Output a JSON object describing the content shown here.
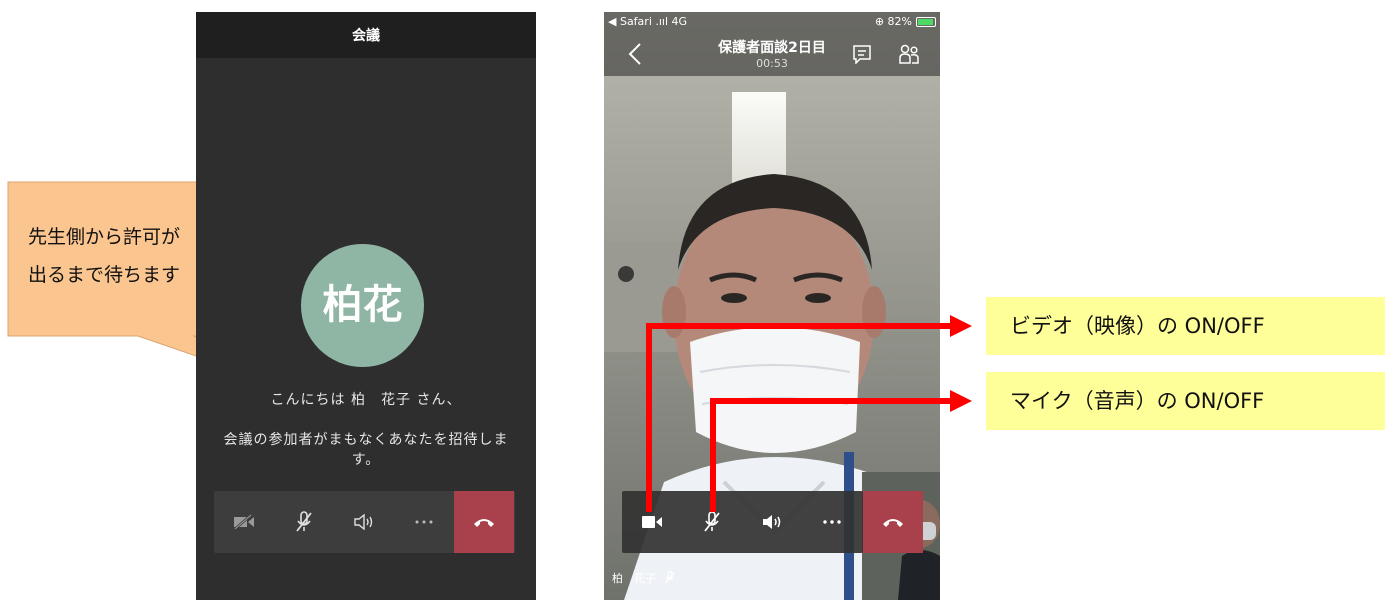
{
  "lobby": {
    "title": "会議",
    "avatar_initials": "柏花",
    "greeting": "こんにちは 柏　花子 さん、",
    "message": "会議の参加者がまもなくあなたを招待します。",
    "controls": [
      {
        "icon": "video-off-icon",
        "state": "off"
      },
      {
        "icon": "mic-muted-icon",
        "state": "muted"
      },
      {
        "icon": "speaker-icon",
        "state": "on"
      },
      {
        "icon": "more-icon"
      },
      {
        "icon": "hang-up-icon",
        "color": "#a8414b"
      }
    ],
    "avatar_color": "#8fb5a5"
  },
  "callout": {
    "text_line1": "先生側から許可が",
    "text_line2": "出るまで待ちます",
    "color": "#fbc58f"
  },
  "call": {
    "status_left": "◀ Safari .ııl 4G",
    "status_right": "⊕ 82%",
    "title": "保護者面談2日目",
    "timer": "00:53",
    "self_caption": "柏　花子",
    "controls": [
      {
        "icon": "video-on-icon",
        "state": "on"
      },
      {
        "icon": "mic-muted-icon",
        "state": "muted"
      },
      {
        "icon": "speaker-icon",
        "state": "on"
      },
      {
        "icon": "more-icon"
      },
      {
        "icon": "hang-up-icon",
        "color": "#a8414b"
      }
    ]
  },
  "annotations": {
    "video_label": "ビデオ（映像）の ON/OFF",
    "mic_label": "マイク（音声）の ON/OFF",
    "arrow_color": "#ff0000",
    "label_bg": "#ffff99"
  }
}
